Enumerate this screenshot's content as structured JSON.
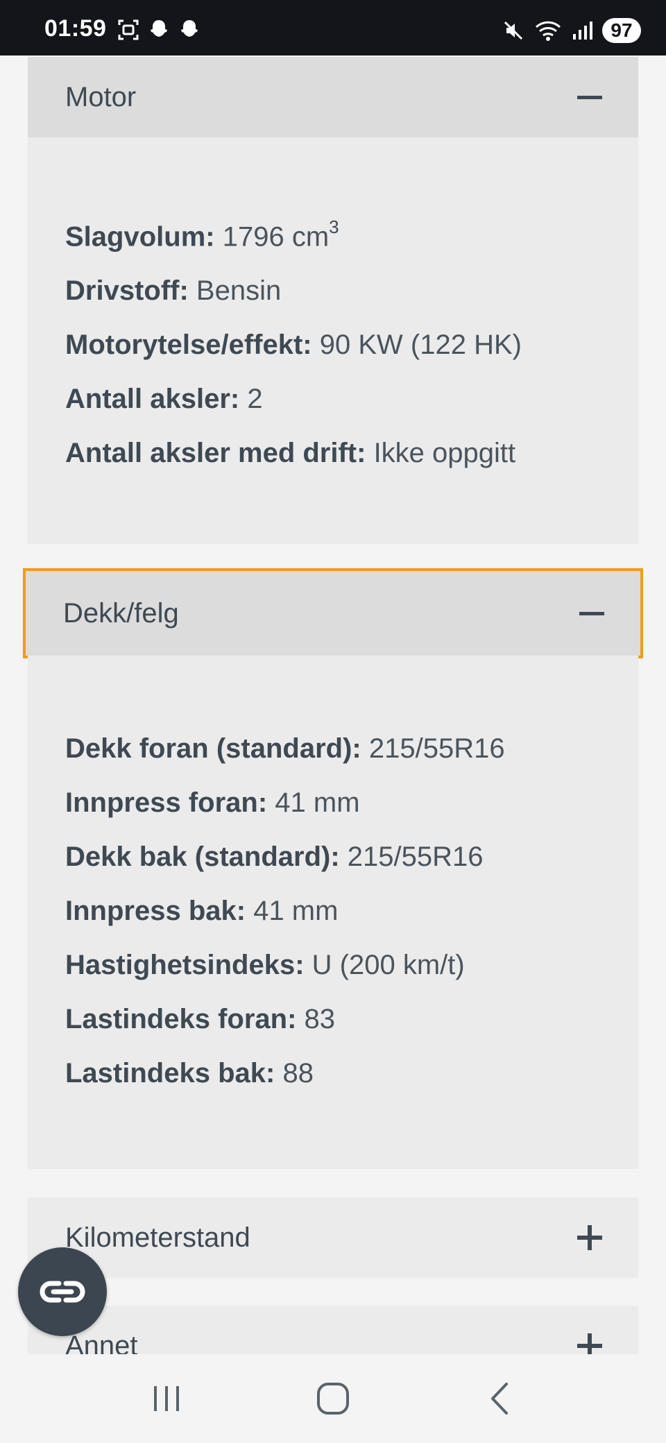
{
  "status_bar": {
    "time": "01:59",
    "battery": "97",
    "left_icons": [
      "screenshot-icon",
      "snapchat-icon",
      "snapchat-icon"
    ],
    "right_icons": [
      "mute-icon",
      "wifi-icon",
      "signal-icon"
    ]
  },
  "sections": {
    "motor": {
      "title": "Motor",
      "rows": [
        {
          "label": "Slagvolum:",
          "value": "1796 cm",
          "sup": "3"
        },
        {
          "label": "Drivstoff:",
          "value": "Bensin"
        },
        {
          "label": "Motorytelse/effekt:",
          "value": "90 KW (122 HK)"
        },
        {
          "label": "Antall aksler:",
          "value": "2"
        },
        {
          "label": "Antall aksler med drift:",
          "value": "Ikke oppgitt"
        }
      ]
    },
    "dekk": {
      "title": "Dekk/felg",
      "rows": [
        {
          "label": "Dekk foran (standard):",
          "value": "215/55R16"
        },
        {
          "label": "Innpress foran:",
          "value": "41 mm"
        },
        {
          "label": "Dekk bak (standard):",
          "value": "215/55R16"
        },
        {
          "label": "Innpress bak:",
          "value": "41 mm"
        },
        {
          "label": "Hastighetsindeks:",
          "value": "U (200 km/t)"
        },
        {
          "label": "Lastindeks foran:",
          "value": "83"
        },
        {
          "label": "Lastindeks bak:",
          "value": "88"
        }
      ]
    },
    "kilometerstand": {
      "title": "Kilometerstand"
    },
    "annet": {
      "title": "Annet"
    }
  },
  "colors": {
    "focus_outline": "#f29a1d",
    "header_bg": "#dcdcdc",
    "body_bg": "#ebebeb",
    "text": "#3e4953"
  }
}
